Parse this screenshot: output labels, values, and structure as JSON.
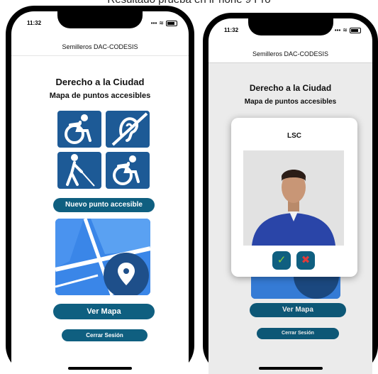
{
  "caption": "Resultado prueba en iPhone 9 Pro",
  "status": {
    "time": "11:32"
  },
  "app": {
    "navbar_title": "Semilleros DAC-CODESIS",
    "title": "Derecho a la Ciudad",
    "subtitle": "Mapa de puntos accesibles",
    "new_point_label": "Nuevo punto accesible",
    "view_map_label": "Ver Mapa",
    "logout_label": "Cerrar Sesión"
  },
  "modal": {
    "title": "LSC",
    "confirm_icon": "check-icon",
    "cancel_icon": "x-icon"
  },
  "icons": [
    "wheelchair-icon",
    "hearing-icon",
    "blind-person-icon",
    "wheelchair-icon"
  ],
  "colors": {
    "primary": "#0f5f80",
    "tile": "#1d5a96",
    "map": "#2e7be0",
    "confirm": "#8bd13b",
    "cancel": "#e03b3b"
  }
}
